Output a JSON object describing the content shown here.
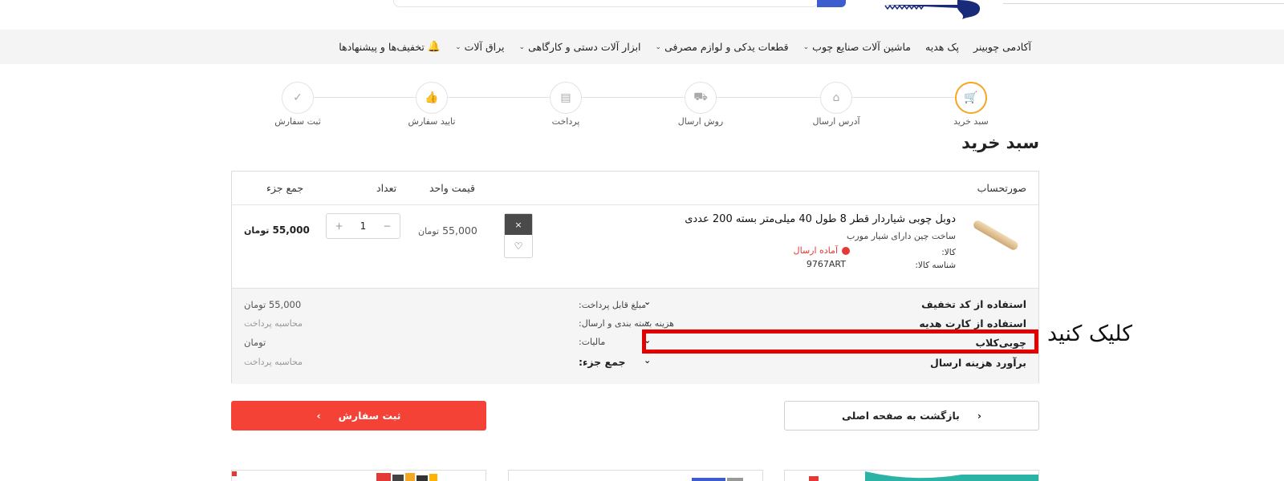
{
  "nav": {
    "items": [
      {
        "label": "تخفیف‌ها و پیشنهادها",
        "has_chevron": false,
        "icon": "bell-icon"
      },
      {
        "label": "یراق آلات",
        "has_chevron": true
      },
      {
        "label": "ابزار آلات دستی و کارگاهی",
        "has_chevron": true
      },
      {
        "label": "قطعات یدکی و لوازم مصرفی",
        "has_chevron": true
      },
      {
        "label": "ماشین آلات صنایع چوب",
        "has_chevron": true
      },
      {
        "label": "پک هدیه",
        "has_chevron": false
      },
      {
        "label": "آکادمی چوبینر",
        "has_chevron": false
      }
    ]
  },
  "steps": [
    {
      "label": "سبد خرید",
      "icon": "cart-bag-icon",
      "active": true
    },
    {
      "label": "آدرس ارسال",
      "icon": "home-icon",
      "active": false
    },
    {
      "label": "روش ارسال",
      "icon": "truck-icon",
      "active": false
    },
    {
      "label": "پرداخت",
      "icon": "card-icon",
      "active": false
    },
    {
      "label": "تایید سفارش",
      "icon": "thumbs-up-icon",
      "active": false
    },
    {
      "label": "ثبت سفارش",
      "icon": "check-icon",
      "active": false
    }
  ],
  "page_title": "سبد خرید",
  "cart": {
    "headers": {
      "invoice": "صورتحساب",
      "unit_price": "قیمت واحد",
      "quantity": "تعداد",
      "subtotal": "جمع جزء"
    },
    "product": {
      "title": "دوبل چوبی شیاردار قطر 8 طول 40 میلی‌متر بسته 200 عددی",
      "subtitle": "ساخت چین دارای شیار مورب",
      "kala_label": "کالا:",
      "status": "آماده ارسال",
      "id_label": "شناسه کالا:",
      "id": "9767ART",
      "remove": "×",
      "wishlist": "♡",
      "unit_price": "55,000",
      "currency": "تومان",
      "quantity": "1",
      "minus": "−",
      "plus": "+",
      "subtotal": "55,000"
    },
    "summary": {
      "rows": [
        {
          "label": "استفاده از کد تخفیف"
        },
        {
          "label": "استفاده از کارت هدیه"
        },
        {
          "label": "چوبی‌کلاب"
        },
        {
          "label": "برآورد هزینه ارسال"
        }
      ],
      "chevron": "⌄",
      "lines": [
        {
          "label": "مبلغ قابل پرداخت:",
          "value": "55,000",
          "currency": "تومان"
        },
        {
          "label": "هزینه بسته بندی و ارسال:",
          "value": "محاسبه پرداخت"
        },
        {
          "label": "مالیات:",
          "value": "تومان"
        },
        {
          "label": "جمع جزء:",
          "value": "محاسبه پرداخت"
        }
      ]
    }
  },
  "annotation": {
    "text": "کلیک کنید",
    "color": "#e30000"
  },
  "buttons": {
    "submit": "ثبت سفارش",
    "submit_arrow": "›",
    "back": "بازگشت به صفحه اصلی",
    "back_arrow": "‹"
  },
  "colors": {
    "accent": "#f44336",
    "step_active": "#f5a623",
    "status": "#e53935",
    "brand_blue": "#3d5dcf"
  }
}
